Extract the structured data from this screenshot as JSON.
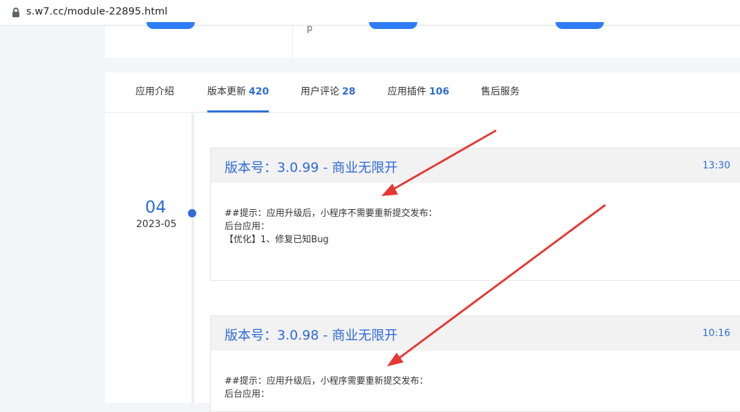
{
  "browser": {
    "url": "s.w7.cc/module-22895.html"
  },
  "info_card": {
    "stray_char": "p"
  },
  "tabs": [
    {
      "label": "应用介绍",
      "count": ""
    },
    {
      "label": "版本更新",
      "count": "420"
    },
    {
      "label": "用户评论",
      "count": "28"
    },
    {
      "label": "应用插件",
      "count": "106"
    },
    {
      "label": "售后服务",
      "count": ""
    }
  ],
  "timeline": {
    "day": "04",
    "month": "2023-05"
  },
  "versions": [
    {
      "title": "版本号：3.0.99 - 商业无限开",
      "time": "13:30",
      "lines": [
        "##提示：应用升级后，小程序不需要重新提交发布：",
        "后台应用：",
        "【优化】1、修复已知Bug"
      ]
    },
    {
      "title": "版本号：3.0.98 - 商业无限开",
      "time": "10:16",
      "lines": [
        "##提示：应用升级后，小程序需要重新提交发布：",
        "后台应用："
      ]
    }
  ],
  "colors": {
    "accent": "#2f6bd9",
    "annotation_arrow": "#e53935",
    "pill": "#2f7df6"
  },
  "icons": {
    "lock": "lock-icon"
  }
}
